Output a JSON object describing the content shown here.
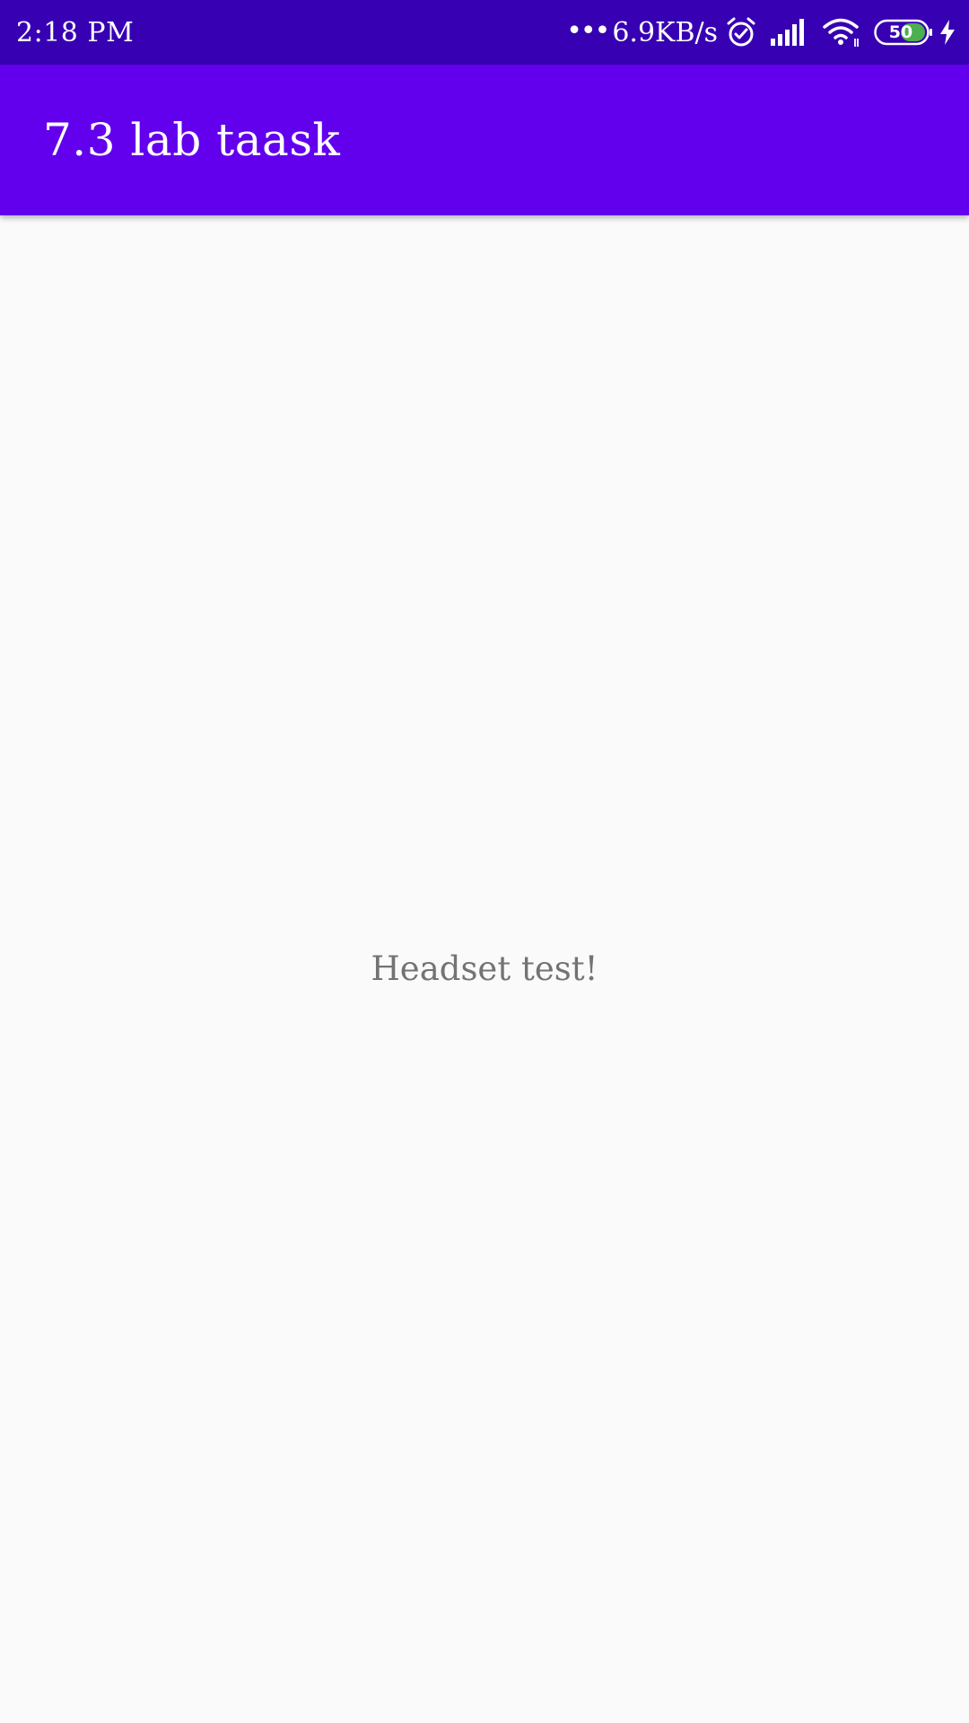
{
  "status_bar": {
    "time": "2:18 PM",
    "network_dots": "•••",
    "network_speed": "6.9KB/s",
    "battery_level": "50",
    "icons": [
      "alarm-icon",
      "signal-icon",
      "wifi-icon",
      "battery-icon",
      "charging-icon"
    ],
    "battery_fill_color": "#4caf50"
  },
  "app_bar": {
    "title": "7.3 lab taask",
    "color": "#6200ee"
  },
  "main": {
    "message": "Headset test!"
  },
  "colors": {
    "status_bar": "#3700b3",
    "background": "#fafafa",
    "text": "#737373"
  }
}
